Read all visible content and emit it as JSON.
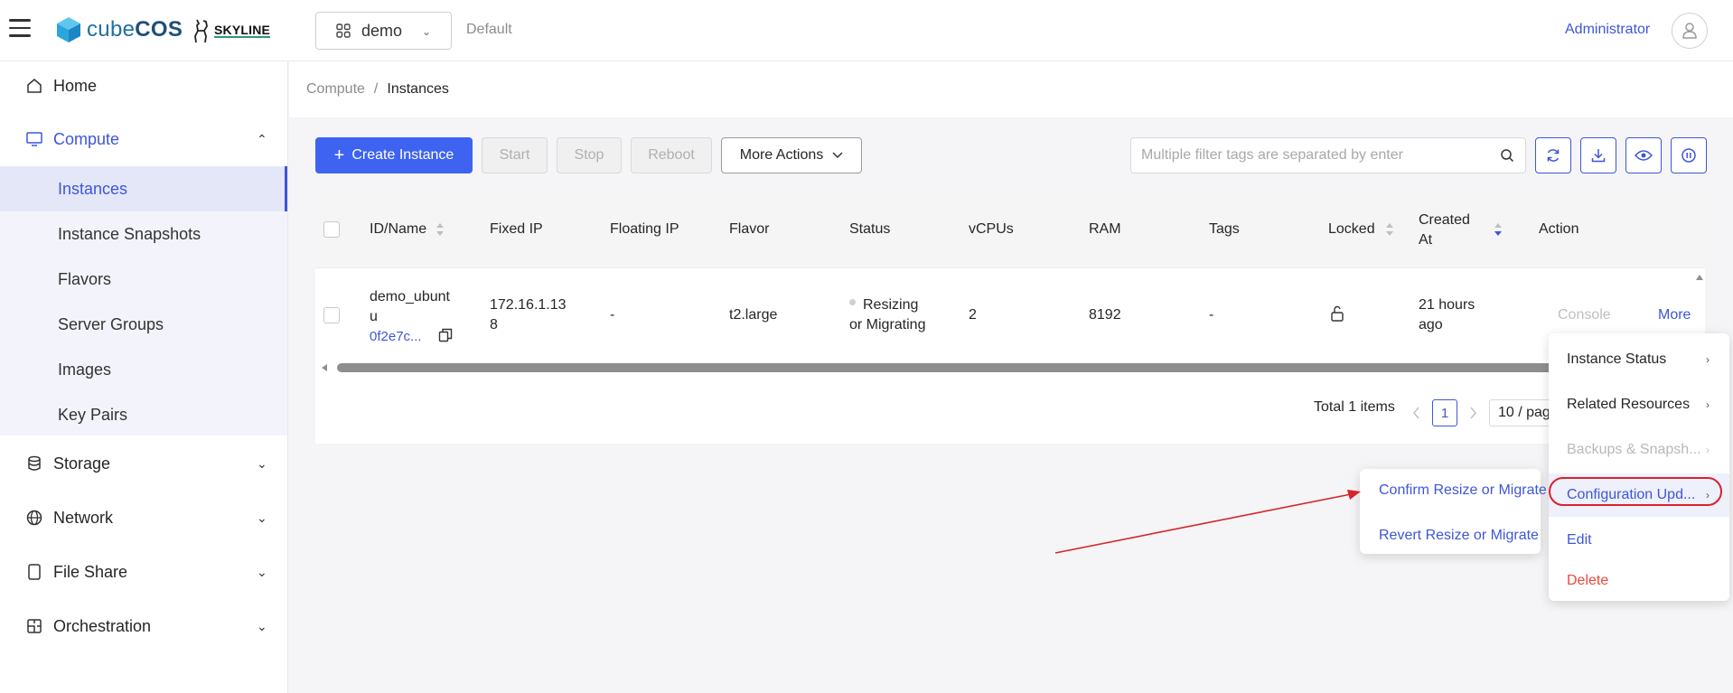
{
  "header": {
    "brand_prefix": "cube",
    "brand_suffix": "COS",
    "partner": "SKYLINE",
    "project": "demo",
    "domain": "Default",
    "user": "Administrator"
  },
  "sidebar": {
    "home": "Home",
    "compute": "Compute",
    "compute_items": [
      "Instances",
      "Instance Snapshots",
      "Flavors",
      "Server Groups",
      "Images",
      "Key Pairs"
    ],
    "storage": "Storage",
    "network": "Network",
    "file_share": "File Share",
    "orchestration": "Orchestration"
  },
  "breadcrumb": {
    "parent": "Compute",
    "separator": "/",
    "current": "Instances"
  },
  "toolbar": {
    "create": "Create Instance",
    "start": "Start",
    "stop": "Stop",
    "reboot": "Reboot",
    "more_actions": "More Actions",
    "search_placeholder": "Multiple filter tags are separated by enter"
  },
  "table": {
    "columns": {
      "id_name": "ID/Name",
      "fixed_ip": "Fixed IP",
      "floating_ip": "Floating IP",
      "flavor": "Flavor",
      "status": "Status",
      "vcpus": "vCPUs",
      "ram": "RAM",
      "tags": "Tags",
      "locked": "Locked",
      "created_at_1": "Created",
      "created_at_2": "At",
      "action": "Action"
    },
    "row": {
      "name_1": "demo_ubunt",
      "name_2": "u",
      "id": "0f2e7c...",
      "fixed_ip_1": "172.16.1.13",
      "fixed_ip_2": "8",
      "floating_ip": "-",
      "flavor": "t2.large",
      "status_1": "Resizing",
      "status_2": "or Migrating",
      "vcpus": "2",
      "ram": "8192",
      "tags": "-",
      "created_1": "21 hours",
      "created_2": "ago",
      "console": "Console",
      "more": "More"
    }
  },
  "pagination": {
    "total": "Total 1 items",
    "page": "1",
    "page_size": "10 / page"
  },
  "more_menu": {
    "items": [
      "Instance Status",
      "Related Resources",
      "Backups & Snapsh...",
      "Configuration Upd...",
      "Edit",
      "Delete"
    ]
  },
  "config_submenu": {
    "items": [
      "Confirm Resize or Migrate",
      "Revert Resize or Migrate"
    ]
  },
  "colors": {
    "accent": "#3e56d8",
    "primary_button": "#3e63f0",
    "danger": "#f0453d",
    "annotation": "#d8232a"
  }
}
